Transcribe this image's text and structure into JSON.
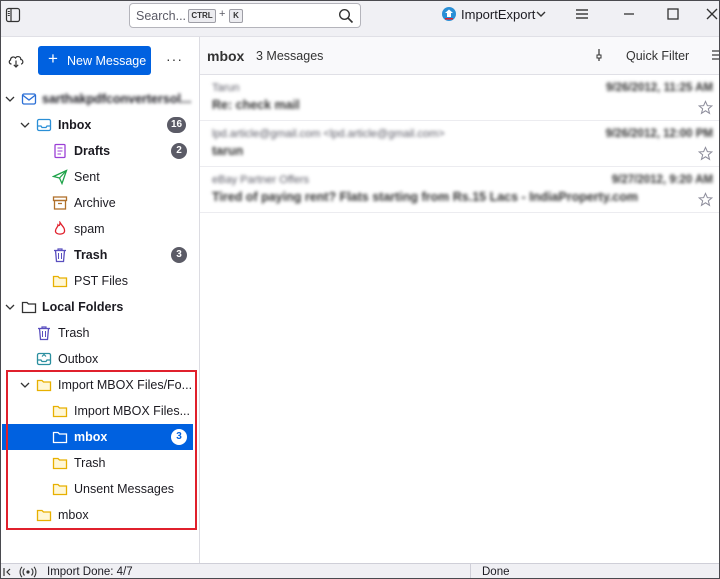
{
  "titlebar": {
    "search_placeholder": "Search...",
    "kbd_ctrl": "CTRL",
    "kbd_plus": "+",
    "kbd_k": "K",
    "addon_label": "ImportExport"
  },
  "sidebar": {
    "new_message": "New Message",
    "more": "···",
    "account_name": "sarthakpdfconvertersol...",
    "folders": [
      {
        "label": "Inbox",
        "badge": "16"
      },
      {
        "label": "Drafts",
        "badge": "2"
      },
      {
        "label": "Sent"
      },
      {
        "label": "Archive"
      },
      {
        "label": "spam"
      },
      {
        "label": "Trash",
        "badge": "3"
      },
      {
        "label": "PST Files"
      },
      {
        "label": "Local Folders"
      },
      {
        "label": "Trash"
      },
      {
        "label": "Outbox"
      },
      {
        "label": "Import MBOX Files/Fo..."
      },
      {
        "label": "Import MBOX Files..."
      },
      {
        "label": "mbox",
        "badge": "3"
      },
      {
        "label": "Trash"
      },
      {
        "label": "Unsent Messages"
      },
      {
        "label": "mbox"
      }
    ]
  },
  "main": {
    "folder_name": "mbox",
    "message_count": "3 Messages",
    "quick_filter": "Quick Filter",
    "messages": [
      {
        "from": "Tarun",
        "subject": "Re: check mail",
        "date": "9/26/2012, 11:25 AM"
      },
      {
        "from": "lpd.article@gmail.com <lpd.article@gmail.com>",
        "subject": "tarun",
        "date": "9/26/2012, 12:00 PM"
      },
      {
        "from": "eBay Partner Offers",
        "subject": "Tired of paying rent? Flats starting from Rs.15 Lacs - IndiaProperty.com",
        "date": "9/27/2012, 9:20 AM"
      }
    ]
  },
  "status": {
    "text": "Import Done: 4/7",
    "done": "Done"
  },
  "colors": {
    "accent": "#0061e0",
    "highlight_box": "#e0202c",
    "folder_yellow": "#e7b000"
  }
}
